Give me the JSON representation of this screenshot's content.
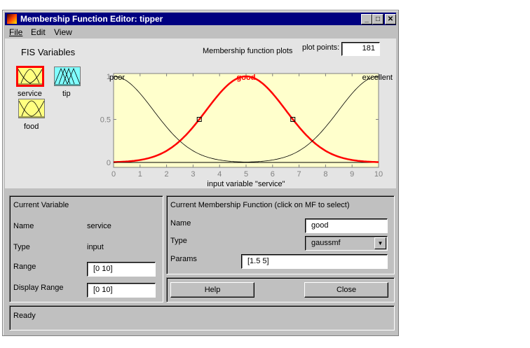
{
  "window": {
    "title": "Membership Function Editor: tipper",
    "minimize": "_",
    "maximize": "□",
    "close": "✕"
  },
  "menu": [
    "File",
    "Edit",
    "View"
  ],
  "fis": {
    "heading": "FIS Variables",
    "variables": [
      {
        "name": "service",
        "selected": true,
        "color": "#ffff80"
      },
      {
        "name": "tip",
        "selected": false,
        "color": "#80ffff"
      },
      {
        "name": "food",
        "selected": false,
        "color": "#ffff80"
      }
    ]
  },
  "plot": {
    "title": "Membership function plots",
    "plot_points_label": "plot points:",
    "plot_points": "181"
  },
  "chart_data": {
    "type": "line",
    "xlabel": "input variable \"service\"",
    "xlim": [
      0,
      10
    ],
    "ylim": [
      0,
      1
    ],
    "xticks": [
      "0",
      "1",
      "2",
      "3",
      "4",
      "5",
      "6",
      "7",
      "8",
      "9",
      "10"
    ],
    "yticks": [
      "0",
      "0.5",
      "1"
    ],
    "series": [
      {
        "name": "poor",
        "mf": "gaussmf",
        "params": [
          1.5,
          0
        ],
        "selected": false
      },
      {
        "name": "good",
        "mf": "gaussmf",
        "params": [
          1.5,
          5
        ],
        "selected": true
      },
      {
        "name": "excellent",
        "mf": "gaussmf",
        "params": [
          1.5,
          10
        ],
        "selected": false
      }
    ],
    "selected_color": "#ff0000",
    "background": "#ffffcc"
  },
  "current_variable": {
    "heading": "Current Variable",
    "name_label": "Name",
    "name": "service",
    "type_label": "Type",
    "type": "input",
    "range_label": "Range",
    "range": "[0 10]",
    "display_range_label": "Display Range",
    "display_range": "[0 10]"
  },
  "current_mf": {
    "heading": "Current Membership Function (click on MF to select)",
    "name_label": "Name",
    "name": "good",
    "type_label": "Type",
    "type": "gaussmf",
    "params_label": "Params",
    "params": "[1.5 5]"
  },
  "buttons": {
    "help": "Help",
    "close": "Close"
  },
  "status": "Ready"
}
